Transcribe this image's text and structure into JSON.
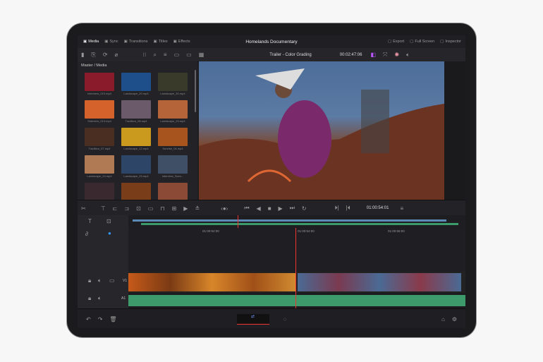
{
  "top_tabs": [
    {
      "label": "Media",
      "icon": "media-icon",
      "active": true
    },
    {
      "label": "Sync",
      "icon": "sync-icon"
    },
    {
      "label": "Transitions",
      "icon": "transitions-icon"
    },
    {
      "label": "Titles",
      "icon": "titles-icon"
    },
    {
      "label": "Effects",
      "icon": "effects-icon"
    }
  ],
  "project_title": "Homelands Documentary",
  "top_right": [
    {
      "label": "Export",
      "icon": "export-icon"
    },
    {
      "label": "Full Screen",
      "icon": "fullscreen-icon"
    },
    {
      "label": "Inspector",
      "icon": "inspector-icon"
    }
  ],
  "timeline_name": "Trailer - Color Grading",
  "viewer_timecode": "00:02:47:06",
  "pool_path": "Master / Media",
  "clips": [
    {
      "name": "Interview_010.mp4",
      "color": "#8a1b2a"
    },
    {
      "name": "Landscape_20.mp4",
      "color": "#1e4f8a"
    },
    {
      "name": "Landscape_30.mp4",
      "color": "#3a3a2a"
    },
    {
      "name": "Sideview_013.mp4",
      "color": "#d4622a"
    },
    {
      "name": "Tradition_08.mp4",
      "color": "#6b5a6a"
    },
    {
      "name": "Landscape_23.mp4",
      "color": "#b5643a"
    },
    {
      "name": "Tradition_07.mp4",
      "color": "#4a2e22"
    },
    {
      "name": "Landscape_12.mp4",
      "color": "#c99a1e"
    },
    {
      "name": "Sunrise_04.mp4",
      "color": "#a8541e"
    },
    {
      "name": "Landscape_24.mp4",
      "color": "#b07a55"
    },
    {
      "name": "Landscape_25.mp4",
      "color": "#2d4566"
    },
    {
      "name": "Interview_Scen...",
      "color": "#3e4f66"
    },
    {
      "name": "Tradition_10.mp4",
      "color": "#3a2a30"
    },
    {
      "name": "Landscape_13.mp4",
      "color": "#7a3d1a"
    },
    {
      "name": "Sunrise_04.mp4",
      "color": "#8a4a35"
    }
  ],
  "transport_timecode": "01:00:54:01",
  "ruler_ticks": [
    "01:00:52:00",
    "01:00:54:00",
    "01:00:56:00"
  ],
  "track_labels": {
    "video": "V1",
    "audio": "A1"
  },
  "colors": {
    "accent": "#e33b3b",
    "audio": "#3d9a6a",
    "mini_video": "#5a8ab5"
  }
}
